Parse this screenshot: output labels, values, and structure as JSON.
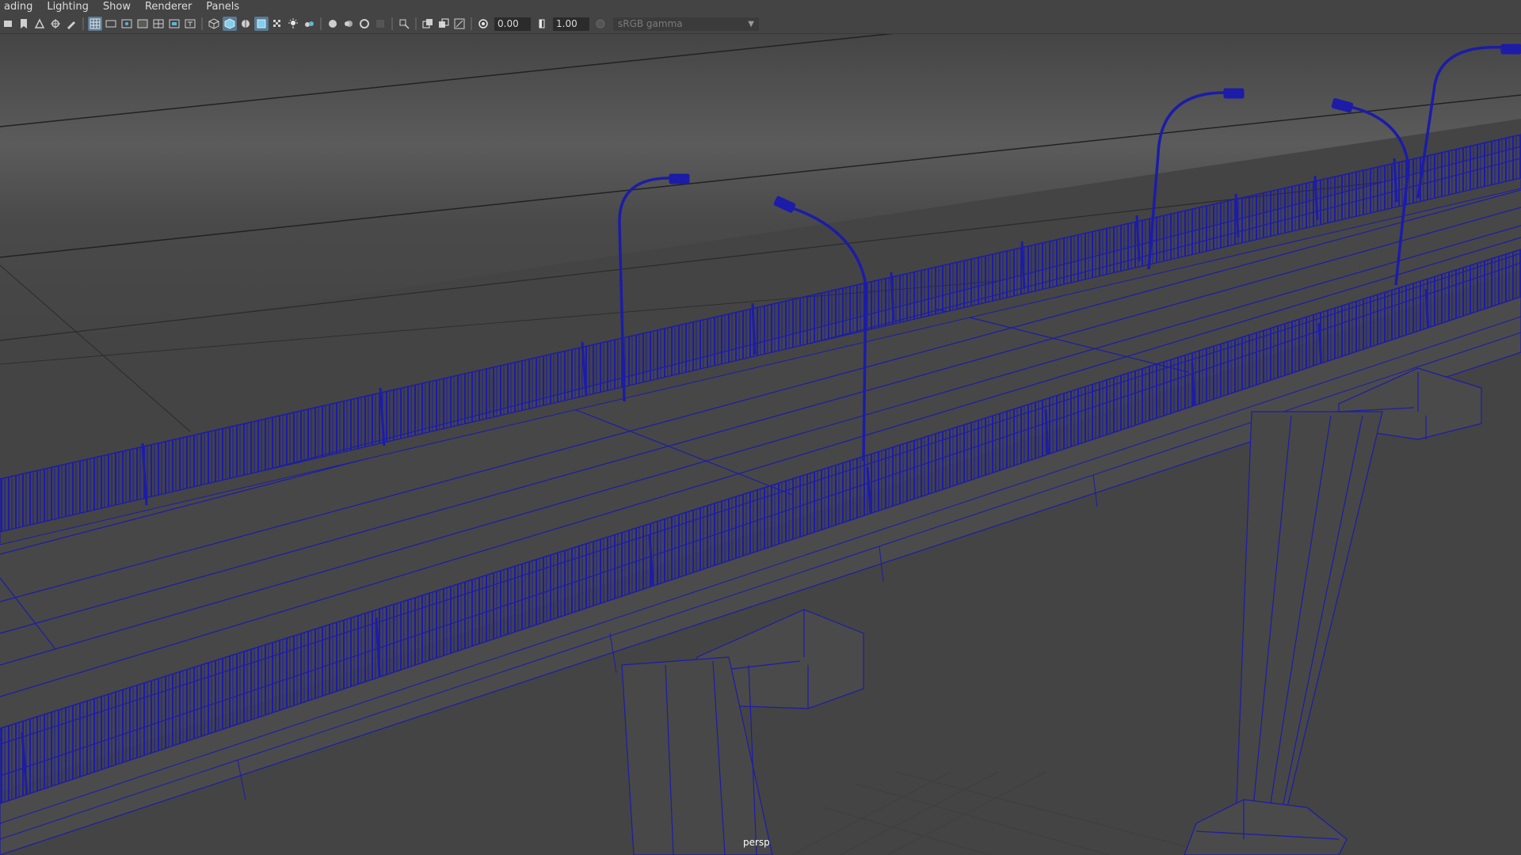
{
  "menubar": {
    "items": [
      "ading",
      "Lighting",
      "Show",
      "Renderer",
      "Panels"
    ]
  },
  "toolbar": {
    "exposure_value": "0.00",
    "gamma_value": "1.00",
    "color_space": "sRGB gamma",
    "icons": [
      "select-camera-icon",
      "camera-attributes-icon",
      "bookmark-icon",
      "image-plane-icon",
      "grid-icon",
      "film-gate-icon",
      "resolution-gate-icon",
      "gate-mask-icon",
      "field-chart-icon",
      "safe-action-icon",
      "safe-title-icon",
      "wireframe-icon",
      "smooth-shade-icon",
      "wireframe-on-shaded-icon",
      "xray-joints-icon",
      "textured-icon",
      "lights-icon",
      "shadows-icon",
      "ambient-occlusion-icon",
      "motion-blur-icon",
      "anti-aliasing-icon",
      "depth-of-field-icon",
      "isolate-select-icon",
      "xray-icon",
      "xray-active-icon",
      "xray-components-icon",
      "exposure-icon",
      "gamma-icon",
      "color-management-icon"
    ]
  },
  "viewport": {
    "camera_label": "persp",
    "wire_color": "#1c1ca8",
    "background_color": "#444444"
  }
}
